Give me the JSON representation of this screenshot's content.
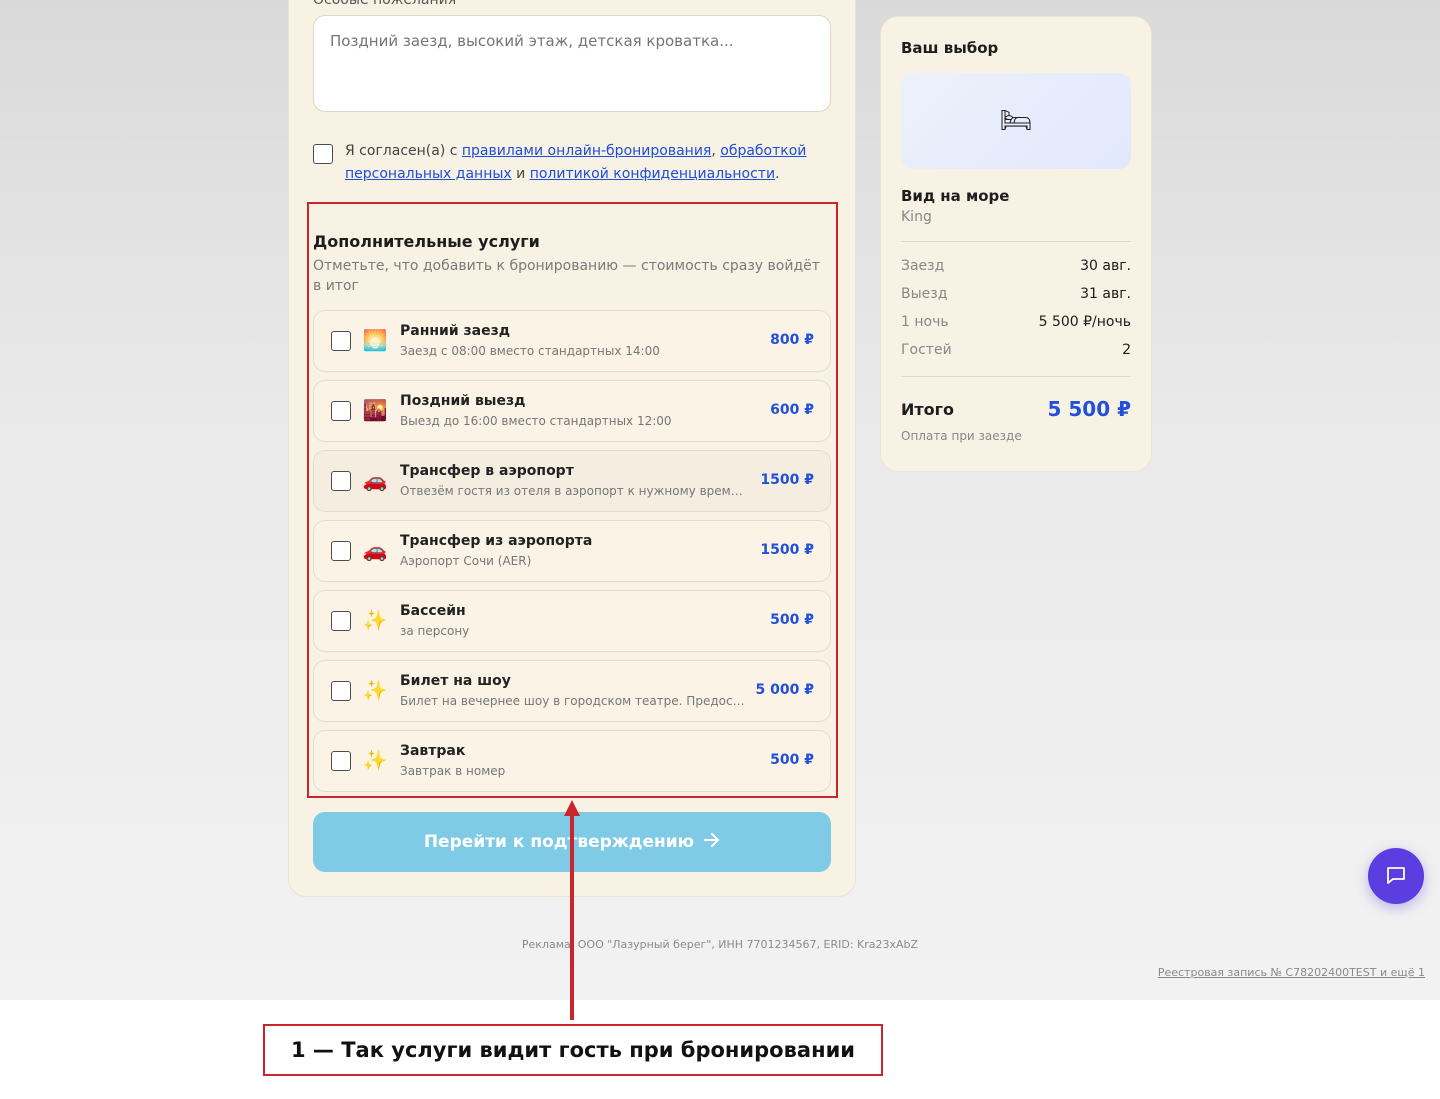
{
  "form": {
    "wishes_label": "Особые пожелания",
    "wishes_placeholder": "Поздний заезд, высокий этаж, детская кроватка...",
    "agree": {
      "prefix": "Я согласен(а) с ",
      "link1": "правилами онлайн-бронирования",
      "sep1": ", ",
      "link2": "обработкой персональных данных",
      "sep2": " и ",
      "link3": "политикой конфиденциальности",
      "suffix": "."
    },
    "services_title": "Дополнительные услуги",
    "services_subtitle": "Отметьте, что добавить к бронированию — стоимость сразу войдёт в итог",
    "services": [
      {
        "icon": "sunrise-icon",
        "glyph": "🌅",
        "name": "Ранний заезд",
        "desc": "Заезд с 08:00 вместо стандартных 14:00",
        "price": "800 ₽"
      },
      {
        "icon": "sunset-icon",
        "glyph": "🌇",
        "name": "Поздний выезд",
        "desc": "Выезд до 16:00 вместо стандартных 12:00",
        "price": "600 ₽"
      },
      {
        "icon": "car-icon",
        "glyph": "🚗",
        "name": "Трансфер в аэропорт",
        "desc": "Отвезём гостя из отеля в аэропорт к нужному времени",
        "price": "1500 ₽"
      },
      {
        "icon": "car-icon",
        "glyph": "🚗",
        "name": "Трансфер из аэропорта",
        "desc": "Аэропорт Сочи (AER)",
        "price": "1500 ₽"
      },
      {
        "icon": "sparkles-icon",
        "glyph": "✨",
        "name": "Бассейн",
        "desc": "за персону",
        "price": "500 ₽"
      },
      {
        "icon": "sparkles-icon",
        "glyph": "✨",
        "name": "Билет на шоу",
        "desc": "Билет на вечернее шоу в городском театре. Предоставляется при заезде",
        "price": "5 000 ₽"
      },
      {
        "icon": "sparkles-icon",
        "glyph": "✨",
        "name": "Завтрак",
        "desc": "Завтрак в номер",
        "price": "500 ₽"
      }
    ],
    "submit_label": "Перейти к подтверждению"
  },
  "summary": {
    "title": "Ваш выбор",
    "room_icon": "bed-icon",
    "room_glyph": "🛏",
    "room_name": "Вид на море",
    "room_type": "King",
    "rows": [
      {
        "k": "Заезд",
        "v": "30 авг."
      },
      {
        "k": "Выезд",
        "v": "31 авг."
      },
      {
        "k": "1 ночь",
        "v": "5 500 ₽/ночь"
      },
      {
        "k": "Гостей",
        "v": "2"
      }
    ],
    "total_label": "Итого",
    "total_value": "5 500 ₽",
    "pay_note": "Оплата при заезде"
  },
  "footer": {
    "ad": "Реклама. ООО \"Лазурный берег\", ИНН 7701234567, ERID: Kra23xAbZ",
    "registry": "Реестровая запись № C78202400TEST и ещё 1"
  },
  "annotation": {
    "caption": "1 — Так услуги видит гость при бронировании"
  },
  "colors": {
    "accent": "#2250d8",
    "highlight": "#c8262c",
    "button": "#7fcbe6",
    "chat": "#5a3ee0"
  }
}
